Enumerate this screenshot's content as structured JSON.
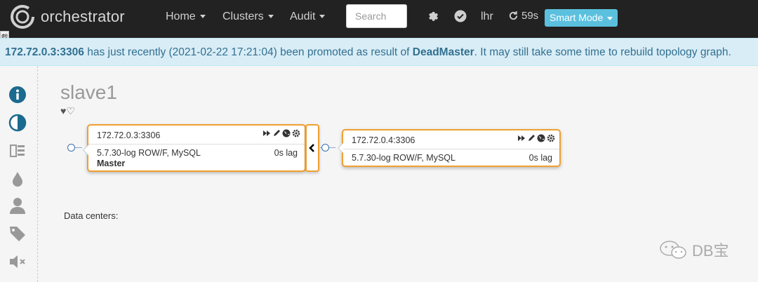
{
  "navbar": {
    "brand": "orchestrator",
    "menus": [
      {
        "label": "Home"
      },
      {
        "label": "Clusters"
      },
      {
        "label": "Audit"
      }
    ],
    "search_placeholder": "Search",
    "period_label": "lhr",
    "refresh_countdown": "59s",
    "mode_button": "Smart Mode",
    "side_tab": "载"
  },
  "alert": {
    "instance": "172.72.0.3:3306",
    "text_1": " has just recently (2021-02-22 17:21:04) been promoted as result of ",
    "reason": "DeadMaster",
    "text_2": ". It may still take some time to rebuild topology graph."
  },
  "sidebar": {
    "icons": [
      "info-icon",
      "contrast-icon",
      "list-icon",
      "drop-icon",
      "user-icon",
      "tag-icon",
      "mute-icon"
    ]
  },
  "cluster": {
    "title": "slave1",
    "hearts": "♥♡"
  },
  "nodes": [
    {
      "host": "172.72.0.3:3306",
      "version": "5.7.30-log ROW/F, MySQL",
      "lag": "0s lag",
      "role": "Master"
    },
    {
      "host": "172.72.0.4:3306",
      "version": "5.7.30-log ROW/F, MySQL",
      "lag": "0s lag",
      "role": ""
    }
  ],
  "data_centers_label": "Data centers:",
  "watermark": "DB宝",
  "colors": {
    "navbar": "#222222",
    "alert_bg": "#d9edf7",
    "alert_text": "#31708f",
    "highlight": "#f0a030",
    "smart_mode": "#5bc0de",
    "sidebar_icon": "#1b6a8f"
  }
}
